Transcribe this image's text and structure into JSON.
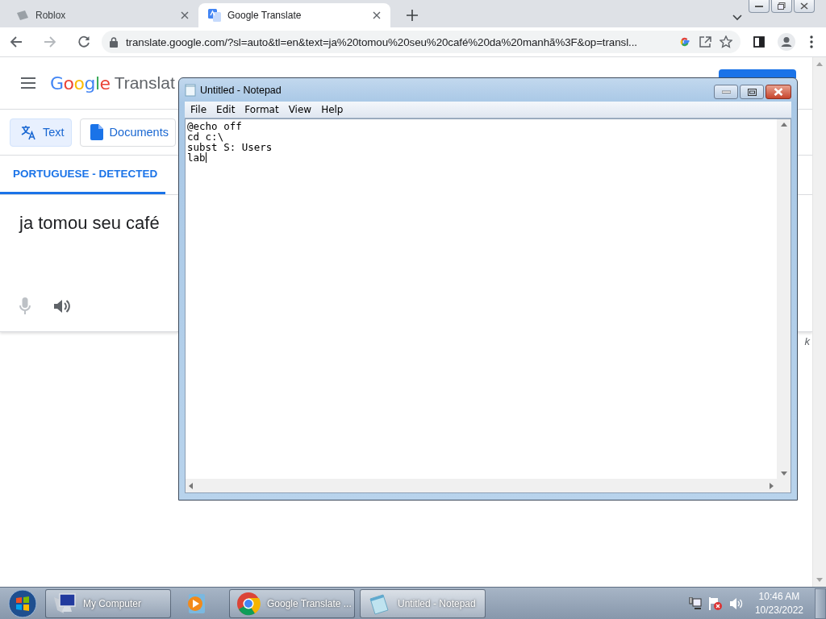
{
  "browser": {
    "tabs": [
      {
        "title": "Roblox",
        "kind": "roblox",
        "selected": false
      },
      {
        "title": "Google Translate",
        "kind": "translate",
        "selected": true
      }
    ],
    "url": "translate.google.com/?sl=auto&tl=en&text=ja%20tomou%20seu%20café%20da%20manhã%3F&op=transl..."
  },
  "translate": {
    "logo": "Google",
    "product": "Translat",
    "modes": [
      {
        "label": "Text",
        "kind": "text",
        "selected": true
      },
      {
        "label": "Documents",
        "kind": "documents",
        "selected": false
      }
    ],
    "source_language": "PORTUGUESE - DETECTED",
    "source_text": "ja tomou seu café",
    "footer_fragment": "k"
  },
  "notepad": {
    "title": "Untitled - Notepad",
    "menu": [
      "File",
      "Edit",
      "Format",
      "View",
      "Help"
    ],
    "text": "@echo off\ncd c:\\\nsubst S: Users\nlab"
  },
  "taskbar": {
    "items": [
      {
        "kind": "computer",
        "label": "My Computer",
        "selected": false
      },
      {
        "kind": "media",
        "selected": false
      },
      {
        "kind": "chrome",
        "label": "Google Translate ...",
        "selected": false
      },
      {
        "kind": "notepad",
        "label": "Untitled - Notepad",
        "selected": true
      }
    ],
    "time": "10:46 AM",
    "date": "10/23/2022"
  }
}
